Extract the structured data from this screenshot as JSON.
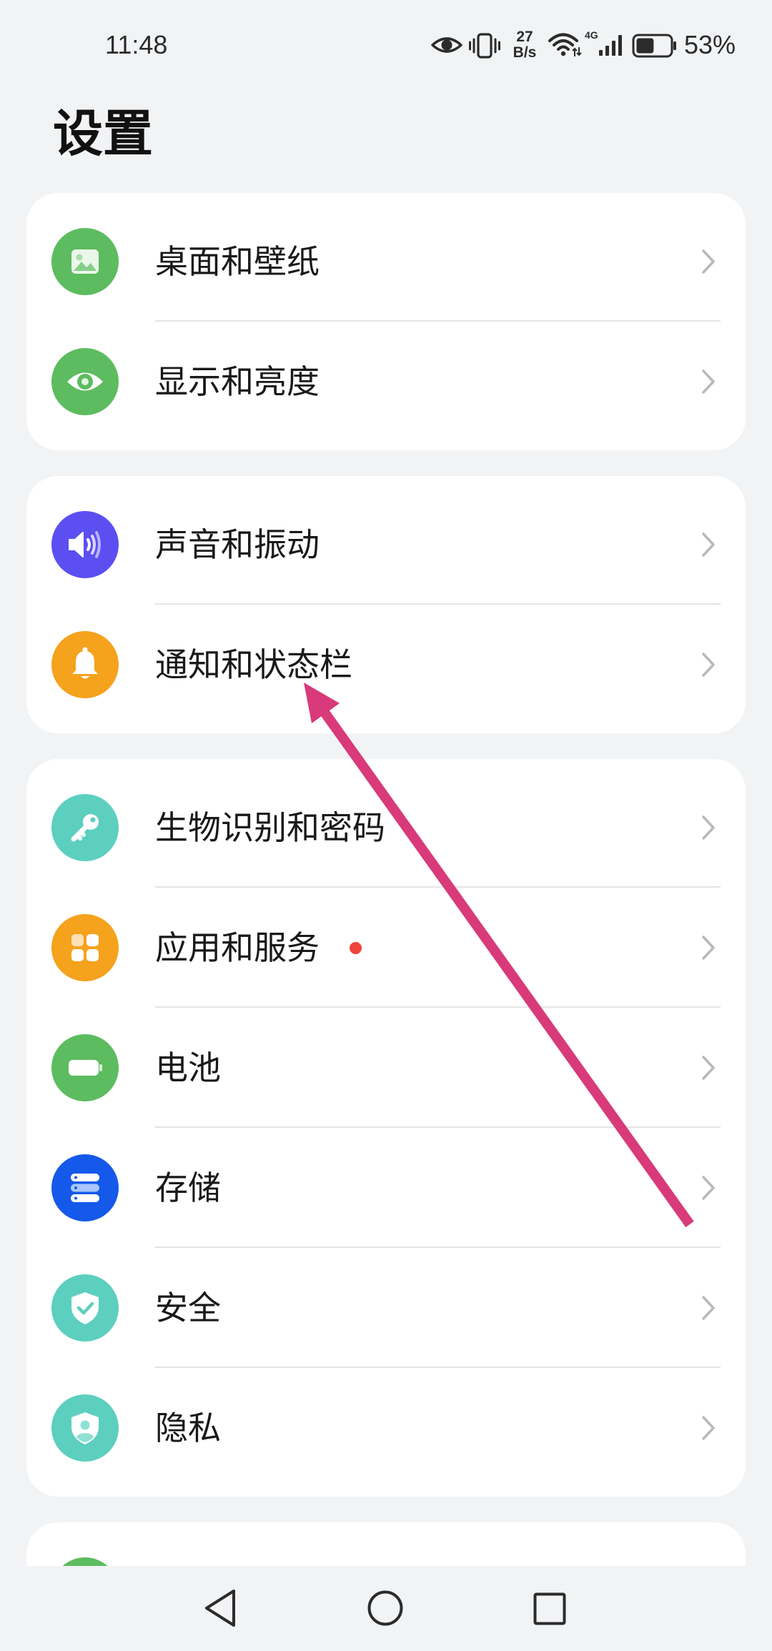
{
  "status_bar": {
    "time": "11:48",
    "net_speed_value": "27",
    "net_speed_unit": "B/s",
    "network_type": "4G",
    "battery_text": "53%",
    "battery_level": 0.53,
    "icons": [
      "eye-comfort-icon",
      "vibrate-icon",
      "wifi-icon",
      "signal-icon",
      "battery-icon"
    ]
  },
  "header": {
    "title": "设置"
  },
  "groups": [
    {
      "items": [
        {
          "label": "桌面和壁纸",
          "icon": "wallpaper-icon",
          "icon_color": "#5cbc5f"
        },
        {
          "label": "显示和亮度",
          "icon": "eye-icon",
          "icon_color": "#5cbc5f"
        }
      ]
    },
    {
      "items": [
        {
          "label": "声音和振动",
          "icon": "speaker-icon",
          "icon_color": "#5b4ff2"
        },
        {
          "label": "通知和状态栏",
          "icon": "bell-icon",
          "icon_color": "#f5a21d"
        }
      ]
    },
    {
      "items": [
        {
          "label": "生物识别和密码",
          "icon": "key-icon",
          "icon_color": "#5ccfbf"
        },
        {
          "label": "应用和服务",
          "icon": "apps-grid-icon",
          "icon_color": "#f5a21d",
          "badge": true,
          "badge_color": "#f0433a"
        },
        {
          "label": "电池",
          "icon": "battery-icon",
          "icon_color": "#5cbc5f"
        },
        {
          "label": "存储",
          "icon": "storage-icon",
          "icon_color": "#1559ea"
        },
        {
          "label": "安全",
          "icon": "shield-check-icon",
          "icon_color": "#5ccfbf"
        },
        {
          "label": "隐私",
          "icon": "privacy-shield-icon",
          "icon_color": "#5ccfbf"
        }
      ]
    },
    {
      "items": [
        {
          "icon_color": "#5cbc5f"
        }
      ]
    }
  ],
  "nav_bar": {
    "icons": [
      "back-icon",
      "home-icon",
      "recents-icon"
    ]
  },
  "annotation_arrow": {
    "color": "#d83a7a"
  }
}
